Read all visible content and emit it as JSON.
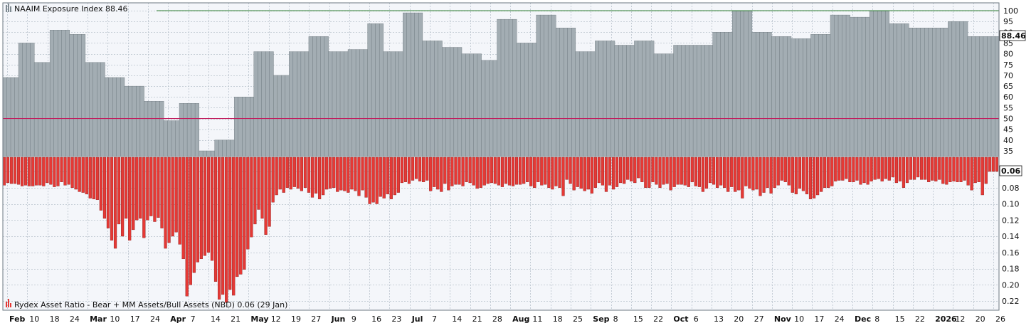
{
  "chart_data": [
    {
      "type": "bar",
      "panel": "upper",
      "legend_label": "NAAIM Exposure Index 88.46",
      "last_value_label": "88.46",
      "y_ticks": [
        "35",
        "40",
        "45",
        "50",
        "55",
        "60",
        "65",
        "70",
        "75",
        "80",
        "85",
        "90",
        "95",
        "100"
      ],
      "ylim": [
        32,
        101
      ],
      "reference_lines": [
        {
          "value": 100,
          "color": "#2e7d32"
        },
        {
          "value": 50,
          "color": "#c2185b"
        }
      ],
      "bar_color": "#a3adb3",
      "values": [
        69,
        69,
        69,
        69,
        85,
        85,
        85,
        85,
        76,
        76,
        76,
        76,
        91,
        91,
        91,
        91,
        91,
        89,
        89,
        89,
        89,
        76,
        76,
        76,
        76,
        76,
        69,
        69,
        69,
        69,
        69,
        65,
        65,
        65,
        65,
        65,
        58,
        58,
        58,
        58,
        58,
        49,
        49,
        49,
        49,
        57,
        57,
        57,
        57,
        57,
        35,
        35,
        35,
        35,
        40,
        40,
        40,
        40,
        40,
        60,
        60,
        60,
        60,
        60,
        81,
        81,
        81,
        81,
        81,
        70,
        70,
        70,
        70,
        81,
        81,
        81,
        81,
        81,
        88,
        88,
        88,
        88,
        88,
        81,
        81,
        81,
        81,
        81,
        82,
        82,
        82,
        82,
        82,
        94,
        94,
        94,
        94,
        81,
        81,
        81,
        81,
        81,
        99,
        99,
        99,
        99,
        99,
        86,
        86,
        86,
        86,
        86,
        83,
        83,
        83,
        83,
        83,
        80,
        80,
        80,
        80,
        80,
        77,
        77,
        77,
        77,
        96,
        96,
        96,
        96,
        96,
        85,
        85,
        85,
        85,
        85,
        98,
        98,
        98,
        98,
        98,
        92,
        92,
        92,
        92,
        92,
        81,
        81,
        81,
        81,
        81,
        86,
        86,
        86,
        86,
        86,
        84,
        84,
        84,
        84,
        84,
        86,
        86,
        86,
        86,
        86,
        80,
        80,
        80,
        80,
        80,
        84,
        84,
        84,
        84,
        84,
        84,
        84,
        84,
        84,
        84,
        90,
        90,
        90,
        90,
        90,
        100,
        100,
        100,
        100,
        100,
        90,
        90,
        90,
        90,
        90,
        88,
        88,
        88,
        88,
        88,
        87,
        87,
        87,
        87,
        87,
        89,
        89,
        89,
        89,
        89,
        98,
        98,
        98,
        98,
        98,
        97,
        97,
        97,
        97,
        97,
        100,
        100,
        100,
        100,
        100,
        94,
        94,
        94,
        94,
        94,
        92,
        92,
        92,
        92,
        92,
        92,
        92,
        92,
        92,
        92,
        95,
        95,
        95,
        95,
        95,
        88,
        88,
        88,
        88,
        88,
        88,
        88,
        88
      ]
    },
    {
      "type": "bar",
      "panel": "lower",
      "legend_label": "Rydex Asset Ratio - Bear + MM Assets/Bull Assets (NBD) 0.06 (29 Jan)",
      "last_value_label": "0.06",
      "y_ticks": [
        "0.06",
        "0.08",
        "0.10",
        "0.12",
        "0.14",
        "0.16",
        "0.18",
        "0.20",
        "0.22"
      ],
      "ylim": [
        0.0575,
        0.2245
      ],
      "inverted": true,
      "bar_color": "#e53935",
      "values": [
        0.077,
        0.074,
        0.075,
        0.075,
        0.076,
        0.078,
        0.077,
        0.078,
        0.078,
        0.077,
        0.077,
        0.078,
        0.074,
        0.076,
        0.079,
        0.078,
        0.073,
        0.077,
        0.076,
        0.08,
        0.082,
        0.085,
        0.086,
        0.088,
        0.093,
        0.094,
        0.095,
        0.108,
        0.118,
        0.13,
        0.145,
        0.155,
        0.125,
        0.14,
        0.118,
        0.145,
        0.132,
        0.12,
        0.118,
        0.142,
        0.12,
        0.115,
        0.122,
        0.117,
        0.13,
        0.155,
        0.148,
        0.14,
        0.135,
        0.15,
        0.168,
        0.214,
        0.2,
        0.185,
        0.172,
        0.168,
        0.164,
        0.16,
        0.17,
        0.196,
        0.218,
        0.212,
        0.222,
        0.206,
        0.213,
        0.19,
        0.187,
        0.181,
        0.156,
        0.141,
        0.125,
        0.107,
        0.118,
        0.138,
        0.128,
        0.098,
        0.089,
        0.082,
        0.086,
        0.08,
        0.082,
        0.079,
        0.081,
        0.084,
        0.08,
        0.086,
        0.092,
        0.087,
        0.094,
        0.089,
        0.082,
        0.081,
        0.08,
        0.085,
        0.083,
        0.084,
        0.086,
        0.082,
        0.084,
        0.09,
        0.083,
        0.092,
        0.1,
        0.098,
        0.1,
        0.091,
        0.093,
        0.088,
        0.094,
        0.089,
        0.086,
        0.074,
        0.073,
        0.075,
        0.071,
        0.069,
        0.072,
        0.073,
        0.071,
        0.084,
        0.079,
        0.082,
        0.085,
        0.075,
        0.083,
        0.078,
        0.076,
        0.076,
        0.078,
        0.073,
        0.074,
        0.077,
        0.081,
        0.08,
        0.077,
        0.075,
        0.074,
        0.075,
        0.077,
        0.079,
        0.075,
        0.077,
        0.078,
        0.076,
        0.076,
        0.075,
        0.073,
        0.078,
        0.08,
        0.073,
        0.077,
        0.076,
        0.08,
        0.082,
        0.078,
        0.08,
        0.09,
        0.07,
        0.075,
        0.083,
        0.079,
        0.081,
        0.084,
        0.082,
        0.087,
        0.08,
        0.074,
        0.077,
        0.085,
        0.077,
        0.082,
        0.079,
        0.074,
        0.075,
        0.07,
        0.072,
        0.074,
        0.068,
        0.073,
        0.08,
        0.08,
        0.073,
        0.076,
        0.08,
        0.076,
        0.075,
        0.083,
        0.079,
        0.076,
        0.076,
        0.077,
        0.079,
        0.073,
        0.078,
        0.079,
        0.085,
        0.081,
        0.074,
        0.076,
        0.08,
        0.077,
        0.08,
        0.085,
        0.079,
        0.085,
        0.083,
        0.093,
        0.078,
        0.081,
        0.083,
        0.082,
        0.09,
        0.086,
        0.08,
        0.087,
        0.08,
        0.077,
        0.071,
        0.073,
        0.077,
        0.086,
        0.088,
        0.081,
        0.084,
        0.088,
        0.094,
        0.093,
        0.089,
        0.085,
        0.08,
        0.08,
        0.078,
        0.072,
        0.071,
        0.071,
        0.069,
        0.073,
        0.073,
        0.071,
        0.076,
        0.074,
        0.076,
        0.072,
        0.07,
        0.069,
        0.072,
        0.069,
        0.071,
        0.067,
        0.074,
        0.072,
        0.08,
        0.074,
        0.07,
        0.07,
        0.067,
        0.07,
        0.07,
        0.073,
        0.071,
        0.072,
        0.07,
        0.075,
        0.076,
        0.073,
        0.072,
        0.073,
        0.073,
        0.071,
        0.077,
        0.083,
        0.074,
        0.073,
        0.089,
        0.075,
        0.06,
        0.06,
        0.06
      ]
    }
  ],
  "x_axis": {
    "labels": [
      {
        "text": "Feb",
        "bold": true
      },
      {
        "text": "10",
        "bold": false
      },
      {
        "text": "18",
        "bold": false
      },
      {
        "text": "24",
        "bold": false
      },
      {
        "text": "Mar",
        "bold": true
      },
      {
        "text": "10",
        "bold": false
      },
      {
        "text": "17",
        "bold": false
      },
      {
        "text": "24",
        "bold": false
      },
      {
        "text": "Apr",
        "bold": true
      },
      {
        "text": "7",
        "bold": false
      },
      {
        "text": "14",
        "bold": false
      },
      {
        "text": "21",
        "bold": false
      },
      {
        "text": "May",
        "bold": true
      },
      {
        "text": "12",
        "bold": false
      },
      {
        "text": "19",
        "bold": false
      },
      {
        "text": "27",
        "bold": false
      },
      {
        "text": "Jun",
        "bold": true
      },
      {
        "text": "9",
        "bold": false
      },
      {
        "text": "16",
        "bold": false
      },
      {
        "text": "23",
        "bold": false
      },
      {
        "text": "Jul",
        "bold": true
      },
      {
        "text": "7",
        "bold": false
      },
      {
        "text": "14",
        "bold": false
      },
      {
        "text": "21",
        "bold": false
      },
      {
        "text": "28",
        "bold": false
      },
      {
        "text": "Aug",
        "bold": true
      },
      {
        "text": "11",
        "bold": false
      },
      {
        "text": "18",
        "bold": false
      },
      {
        "text": "25",
        "bold": false
      },
      {
        "text": "Sep",
        "bold": true
      },
      {
        "text": "8",
        "bold": false
      },
      {
        "text": "15",
        "bold": false
      },
      {
        "text": "22",
        "bold": false
      },
      {
        "text": "Oct",
        "bold": true
      },
      {
        "text": "6",
        "bold": false
      },
      {
        "text": "13",
        "bold": false
      },
      {
        "text": "20",
        "bold": false
      },
      {
        "text": "27",
        "bold": false
      },
      {
        "text": "Nov",
        "bold": true
      },
      {
        "text": "10",
        "bold": false
      },
      {
        "text": "17",
        "bold": false
      },
      {
        "text": "24",
        "bold": false
      },
      {
        "text": "Dec",
        "bold": true
      },
      {
        "text": "8",
        "bold": false
      },
      {
        "text": "15",
        "bold": false
      },
      {
        "text": "22",
        "bold": false
      },
      {
        "text": "2026",
        "bold": true
      },
      {
        "text": "12",
        "bold": false
      },
      {
        "text": "20",
        "bold": false
      },
      {
        "text": "26",
        "bold": false
      }
    ]
  },
  "colors": {
    "background": "#f4f6fa",
    "grid": "#b8c2cc",
    "gray_bar": "#a3adb3",
    "red_bar": "#e53935",
    "green_line": "#2e7d32",
    "red_line": "#c2185b"
  }
}
